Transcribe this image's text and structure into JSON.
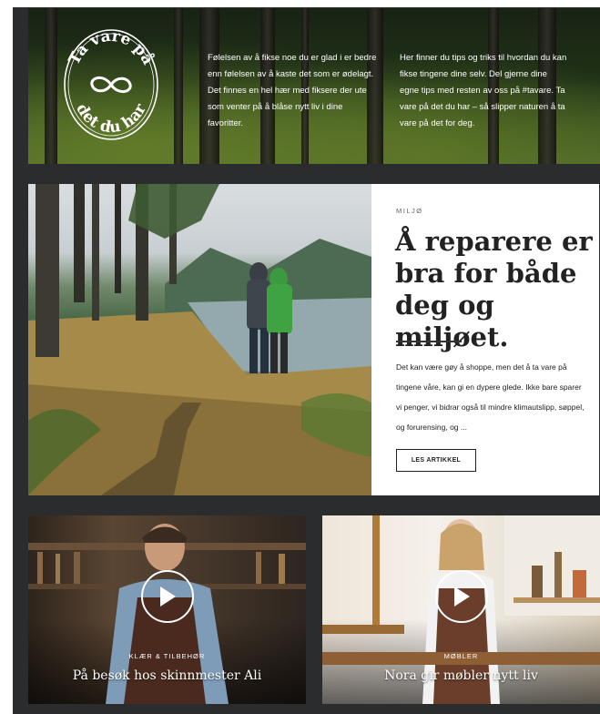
{
  "hero": {
    "badge_top": "Ta vare på",
    "badge_bottom": "det du har",
    "badge_icon": "infinity-icon",
    "col1": "Følelsen av å fikse noe du er glad i er bedre enn følelsen av å kaste det som er ødelagt. Det finnes en hel hær med fiksere der ute som venter på å blåse nytt liv i dine favoritter.",
    "col2": "Her finner du tips og triks til hvordan du kan fikse tingene dine selv. Del gjerne dine egne tips med resten av oss på #tavare. Ta vare på det du har – så slipper naturen å ta vare på det for deg."
  },
  "feature": {
    "eyebrow": "MILJØ",
    "headline_line1": "Å reparere er",
    "headline_line2": "bra for både",
    "headline_line3": "deg og miljøet.",
    "body": "Det kan være gøy å shoppe, men det å ta vare på tingene våre, kan gi en dypere glede. Ikke bare sparer vi penger, vi bidrar også til mindre klimautslipp, søppel, og forurensing, og ...",
    "button_label": "LES ARTIKKEL"
  },
  "cards": [
    {
      "category": "KLÆR & TILBEHØR",
      "title": "På besøk hos skinnmester Ali",
      "icon": "play-icon"
    },
    {
      "category": "MØBLER",
      "title": "Nora gir møbler nytt liv",
      "icon": "play-icon"
    }
  ],
  "colors": {
    "background": "#2b2c2e",
    "text_dark": "#222222",
    "white": "#ffffff"
  }
}
